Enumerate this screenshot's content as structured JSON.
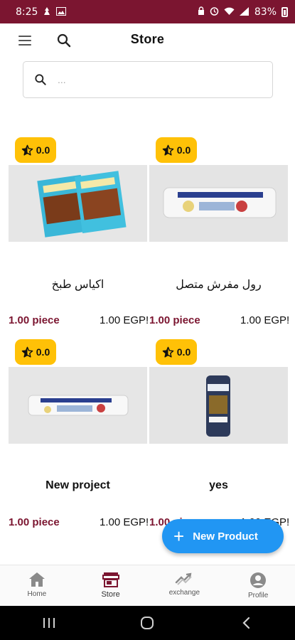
{
  "status_bar": {
    "time": "8:25",
    "battery": "83%"
  },
  "app_bar": {
    "title": "Store"
  },
  "search": {
    "placeholder": "..."
  },
  "products": [
    {
      "rating": "0.0",
      "name": "اكياس طبخ",
      "qty": "1.00 piece",
      "price": "1.00 EGP!"
    },
    {
      "rating": "0.0",
      "name": "رول مفرش متصل",
      "qty": "1.00 piece",
      "price": "1.00 EGP!"
    },
    {
      "rating": "0.0",
      "name": "New project",
      "qty": "1.00 piece",
      "price": "1.00 EGP!"
    },
    {
      "rating": "0.0",
      "name": "yes",
      "qty": "1.00 piece",
      "price": "1.00 EGP!"
    }
  ],
  "fab": {
    "label": "New Product"
  },
  "bottom_nav": {
    "items": [
      {
        "label": "Home"
      },
      {
        "label": "Store"
      },
      {
        "label": "exchange"
      },
      {
        "label": "Profile"
      }
    ]
  },
  "colors": {
    "brand": "#7b1530",
    "accent": "#2196f3",
    "rating_badge": "#ffc107"
  }
}
